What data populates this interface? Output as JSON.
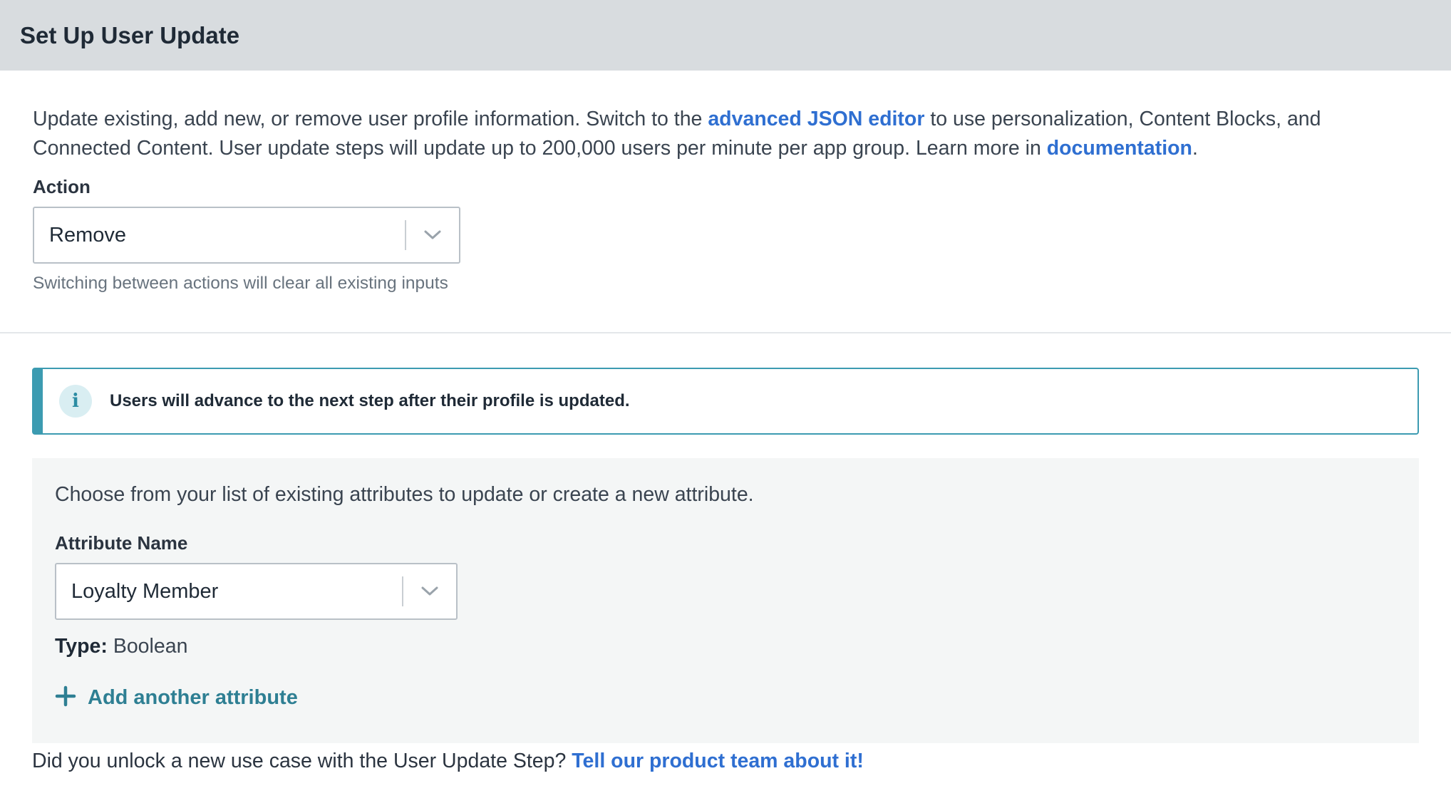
{
  "header": {
    "title": "Set Up User Update"
  },
  "intro": {
    "text_1": "Update existing, add new, or remove user profile information. Switch to the ",
    "link_json_editor": "advanced JSON editor",
    "text_2": " to use personalization, Content Blocks, and",
    "text_3": "Connected Content. User update steps will update up to 200,000 users per minute per app group. Learn more in ",
    "link_documentation": "documentation",
    "text_4": "."
  },
  "action": {
    "label": "Action",
    "selected": "Remove",
    "helper": "Switching between actions will clear all existing inputs"
  },
  "info_banner": {
    "icon": "i",
    "text": "Users will advance to the next step after their profile is updated."
  },
  "attributes": {
    "description": "Choose from your list of existing attributes to update or create a new attribute.",
    "name_label": "Attribute Name",
    "selected": "Loyalty Member",
    "type_key": "Type:",
    "type_value": " Boolean",
    "add_label": "Add another attribute"
  },
  "footer": {
    "text": "Did you unlock a new use case with the User Update Step? ",
    "link": "Tell our product team about it!"
  },
  "colors": {
    "link": "#2f6fd1",
    "accent_teal": "#3c9bb1",
    "add_attr": "#2e7f93",
    "header_bg": "#d8dcdf"
  }
}
